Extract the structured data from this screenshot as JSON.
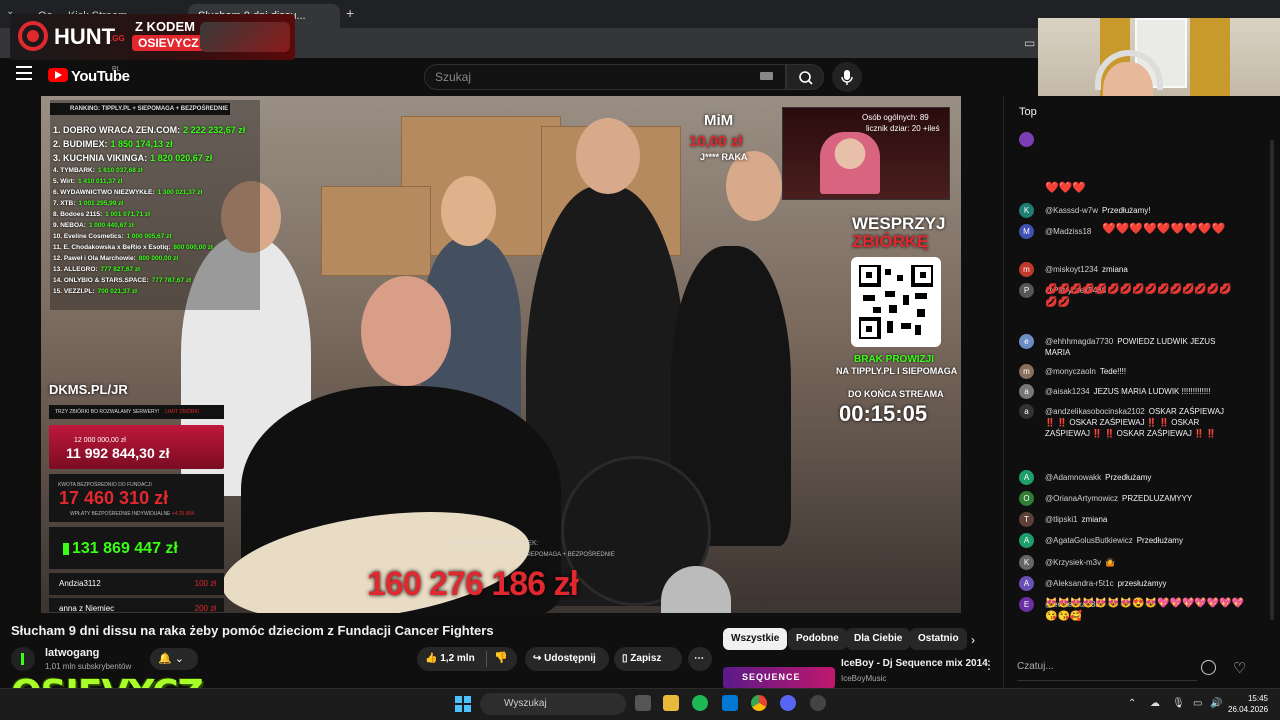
{
  "browser": {
    "tab_inactive_label": "Oo ... Kick Stream ...",
    "tab_active_label": "Słucham 9 dni dissu...",
    "new_tab": "+",
    "tab_menu": "⌄"
  },
  "youtube": {
    "wordmark": "YouTube",
    "country": "PL",
    "search_placeholder": "Szukaj"
  },
  "hunt_banner": {
    "brand": "HUNT",
    "tld": ".GG",
    "code_label": "Z KODEM",
    "code": "OSIEVYCZ"
  },
  "overlay": {
    "ranking_header": "RANKING:   TIPPLY.PL + SIEPOMAGA + BEZPOŚREDNIE",
    "ranking": [
      {
        "label": "1. DOBRO WRACA ZEN.COM:",
        "amount": "2 222 232,67 zł"
      },
      {
        "label": "2. BUDIMEX:",
        "amount": "1 850 174,13 zł"
      },
      {
        "label": "3. KUCHNIA VIKINGA:",
        "amount": "1 820 020,67 zł"
      },
      {
        "label": "4. TYMBARK:",
        "amount": "1 610 037,68 zł"
      },
      {
        "label": "5. Wirt:",
        "amount": "1 410 011,37 zł"
      },
      {
        "label": "6. WYDAWNICTWO NIEZWYKŁE:",
        "amount": "1 300 021,37 zł"
      },
      {
        "label": "7. XTB:",
        "amount": "1 001 295,99 zł"
      },
      {
        "label": "8. Bodoes 2115:",
        "amount": "1 001 071,71 zł"
      },
      {
        "label": "9. NEBOA:",
        "amount": "1 000 440,67 zł"
      },
      {
        "label": "10. Eveline Cosmetics:",
        "amount": "1 000 005,67 zł"
      },
      {
        "label": "11. E. Chodakowska x BeRio x Esotiq:",
        "amount": "800 000,00 zł"
      },
      {
        "label": "12. Paweł i Ola Marchowie:",
        "amount": "800 000,00 zł"
      },
      {
        "label": "13. ALLEGRO:",
        "amount": "777 827,67 zł"
      },
      {
        "label": "14. ONLYBIO & STARS.SPACE:",
        "amount": "777 787,67 zł"
      },
      {
        "label": "15. VEZZI.PL:",
        "amount": "700 021,37 zł"
      }
    ],
    "dkms": "DKMS.PL/JR",
    "counter_bar": "TRZY ZBIÓRKI BO ROZWALAMY SERWERY!",
    "counter_bar_red": "LIMIT ZBIÓRKI",
    "goal_label": "12 000 000,00 zł",
    "goal_amount": "11 992 844,30 zł",
    "fees_label": "KWOTA BEZPOŚREDNIO DO FUNDACJI",
    "fees_amount": "17 460 310 zł",
    "fees_sub": "WPŁATY BEZPOŚREDNIE INDYWIDUALNE",
    "fees_sub_red": "+4 25 804",
    "cash_amount": "131 869 447 zł",
    "donors": [
      {
        "name": "Andzia3112",
        "amount": "100 zł"
      },
      {
        "name": "anna z Niemiec",
        "amount": "200 zł"
      }
    ],
    "total_label": "ŁĄCZNA KWOTA ZBIÓREK:",
    "total_sub": "+ SIEPOMAGA + BEZPOŚREDNIE",
    "total_amount": "160 276 186 zł",
    "mim_label": "MiM",
    "mim_amount": "10,00 zł",
    "mim_sub": "J**** RAKA",
    "inset_count": "Osób ogólnych: 89",
    "inset_licznik": "licznik dziar: 20 +ileś",
    "support_title": "WESPRZYJ",
    "support_title2": "ZBIÓRKĘ",
    "no_fee": "BRAK PROWIZJI",
    "no_fee2": "NA TIPPLY.PL I SIEPOMAGA",
    "countdown_label": "DO KOŃCA STREAMA",
    "countdown": "00:15:05"
  },
  "video": {
    "title": "Słucham 9 dni dissu na raka żeby pomóc dzieciom z Fundacji Cancer Fighters",
    "channel": "latwogang",
    "subs": "1,01 mln subskrybentów",
    "bell": "🔔 ⌄",
    "likes": "1,2 mln",
    "share": "Udostępnij",
    "save": "Zapisz",
    "more": "⋯",
    "dislike": "👎"
  },
  "osievycz_logo": "OSIEVYCZ",
  "chips": [
    "Wszystkie",
    "Podobne",
    "Dla Ciebie",
    "Ostatnio"
  ],
  "chips_next": "›",
  "recommendation": {
    "thumb_text": "SEQUENCE",
    "title": "IceBoy - Dj Sequence mix 2014",
    "channel": "IceBoyMusic",
    "more": "⋮"
  },
  "chat": {
    "top_label": "Top",
    "input_placeholder": "Czatuj...",
    "heart": "♡",
    "messages": [
      {
        "avatar": "K",
        "color": "#1e7e72",
        "author": "@Kasssd-w7w",
        "text": "Przedłużamy!"
      },
      {
        "avatar": "M",
        "color": "#3f51b5",
        "author": "@Madziss18",
        "text": ""
      },
      {
        "avatar": "m",
        "color": "#c0392b",
        "author": "@miskoyt1234",
        "text": "zmiana"
      },
      {
        "avatar": "P",
        "color": "#555",
        "author": "@Patryczek5488",
        "text": ""
      },
      {
        "avatar": "e",
        "color": "#6b8cc4",
        "author": "@ehhhmagda7730",
        "text": "POWIEDZ LUDWIK JEZUS MARIA"
      },
      {
        "avatar": "m",
        "color": "#8a6e5c",
        "author": "@monyczaoln",
        "text": "Tede!!!!"
      },
      {
        "avatar": "a",
        "color": "#777",
        "author": "@aisak1234",
        "text": "JEZUS MARIA LUDWIK !!!!!!!!!!!!!"
      },
      {
        "avatar": "a",
        "color": "#333",
        "author": "@andzelikasobocinska2102",
        "text": "OSKAR ZAŚPIEWAJ ‼️ ‼️ OSKAR ZAŚPIEWAJ ‼️ ‼️ OSKAR ZAŚPIEWAJ ‼️ ‼️ OSKAR ZAŚPIEWAJ ‼️ ‼️"
      },
      {
        "avatar": "A",
        "color": "#1e9e6a",
        "author": "@Adamnowakk",
        "text": "Przedłużamy"
      },
      {
        "avatar": "O",
        "color": "#2e7d32",
        "author": "@OrianaArtymowicz",
        "text": "PRZEDLUZAMYYY"
      },
      {
        "avatar": "T",
        "color": "#5d4037",
        "author": "@tlipski1",
        "text": "zmiana"
      },
      {
        "avatar": "A",
        "color": "#1e9e6a",
        "author": "@AgataGolusButkiewicz",
        "text": "Przedłużamy"
      },
      {
        "avatar": "K",
        "color": "#666",
        "author": "@Krzysiek-m3v",
        "text": "🤷"
      },
      {
        "avatar": "A",
        "color": "#6a4fb5",
        "author": "@Aleksandra-r5t1c",
        "text": "przesłużamyy"
      },
      {
        "avatar": "E",
        "color": "#6a2fa5",
        "author": "@ewaewka7385",
        "text": ""
      }
    ],
    "emoji_rows": {
      "top_hearts": "❤️❤️❤️",
      "madziss_hearts": "❤️❤️❤️❤️❤️❤️❤️❤️❤️",
      "patryczek_emojis": "💋💋💋💋💋💋💋💋💋💋💋💋💋💋💋💋💋",
      "ewa_emojis": "😻😻😻😻😻😻😻😍😻💖💖💖💖💖💖💖😘😘🥰"
    }
  },
  "taskbar": {
    "search": "Wyszukaj",
    "time": "15:45",
    "date": "26.04.2026"
  }
}
